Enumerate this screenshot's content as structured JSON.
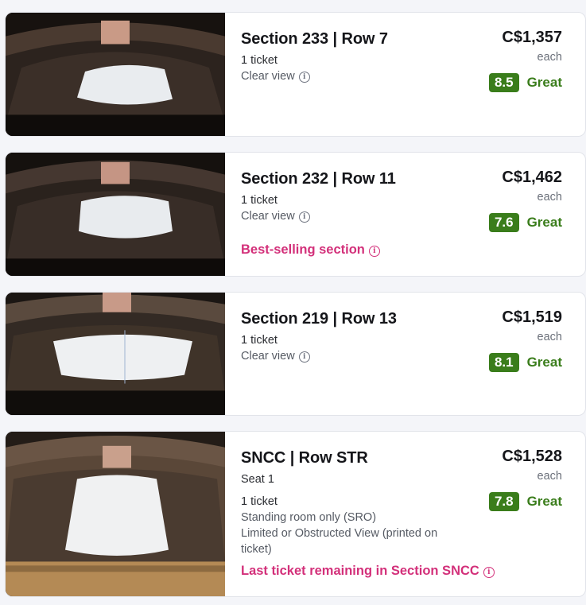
{
  "listings": [
    {
      "title": "Section 233 | Row 7",
      "tickets": "1 ticket",
      "view": "Clear view",
      "price": "C$1,357",
      "each": "each",
      "score": "8.5",
      "rating": "Great"
    },
    {
      "title": "Section 232 | Row 11",
      "tickets": "1 ticket",
      "view": "Clear view",
      "highlight": "Best-selling section",
      "price": "C$1,462",
      "each": "each",
      "score": "7.6",
      "rating": "Great"
    },
    {
      "title": "Section 219 | Row 13",
      "tickets": "1 ticket",
      "view": "Clear view",
      "price": "C$1,519",
      "each": "each",
      "score": "8.1",
      "rating": "Great"
    },
    {
      "title": "SNCC | Row STR",
      "seat": "Seat 1",
      "tickets": "1 ticket",
      "notes": [
        "Standing room only (SRO)",
        "Limited or Obstructed View (printed on",
        "ticket)"
      ],
      "highlight": "Last ticket remaining in Section SNCC",
      "price": "C$1,528",
      "each": "each",
      "score": "7.8",
      "rating": "Great"
    }
  ],
  "colors": {
    "rating_green": "#3a7d1b",
    "highlight_pink": "#d3307a"
  },
  "icons": {
    "info": "info-icon",
    "venue_view": "arena-view-image"
  }
}
